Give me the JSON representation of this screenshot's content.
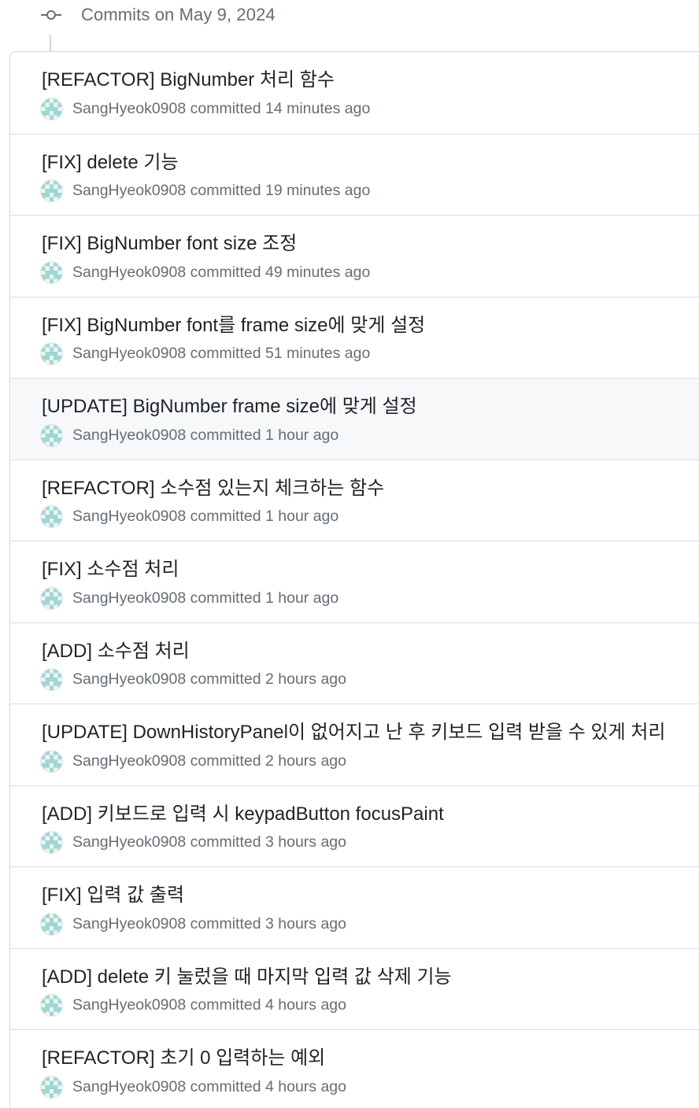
{
  "group": {
    "title": "Commits on May 9, 2024",
    "icon": "git-commit-icon"
  },
  "colors": {
    "avatar_teal": "#9fd7d2",
    "avatar_light": "#eef4f4",
    "hover_row": "#f6f8fa",
    "muted_text": "#656d76"
  },
  "commits": [
    {
      "title": "[REFACTOR] BigNumber 처리 함수",
      "author": "SangHyeok0908",
      "action": "committed",
      "time": "14 minutes ago"
    },
    {
      "title": "[FIX] delete 기능",
      "author": "SangHyeok0908",
      "action": "committed",
      "time": "19 minutes ago"
    },
    {
      "title": "[FIX] BigNumber font size 조정",
      "author": "SangHyeok0908",
      "action": "committed",
      "time": "49 minutes ago"
    },
    {
      "title": "[FIX] BigNumber font를 frame size에 맞게 설정",
      "author": "SangHyeok0908",
      "action": "committed",
      "time": "51 minutes ago"
    },
    {
      "title": "[UPDATE] BigNumber frame size에 맞게 설정",
      "author": "SangHyeok0908",
      "action": "committed",
      "time": "1 hour ago"
    },
    {
      "title": "[REFACTOR] 소수점 있는지 체크하는 함수",
      "author": "SangHyeok0908",
      "action": "committed",
      "time": "1 hour ago"
    },
    {
      "title": "[FIX] 소수점 처리",
      "author": "SangHyeok0908",
      "action": "committed",
      "time": "1 hour ago"
    },
    {
      "title": "[ADD] 소수점 처리",
      "author": "SangHyeok0908",
      "action": "committed",
      "time": "2 hours ago"
    },
    {
      "title": "[UPDATE] DownHistoryPanel이 없어지고 난 후 키보드 입력 받을 수 있게 처리",
      "author": "SangHyeok0908",
      "action": "committed",
      "time": "2 hours ago"
    },
    {
      "title": "[ADD] 키보드로 입력 시 keypadButton focusPaint",
      "author": "SangHyeok0908",
      "action": "committed",
      "time": "3 hours ago"
    },
    {
      "title": "[FIX] 입력 값 출력",
      "author": "SangHyeok0908",
      "action": "committed",
      "time": "3 hours ago"
    },
    {
      "title": "[ADD] delete 키 눌렀을 때 마지막 입력 값 삭제 기능",
      "author": "SangHyeok0908",
      "action": "committed",
      "time": "4 hours ago"
    },
    {
      "title": "[REFACTOR] 초기 0 입력하는 예외",
      "author": "SangHyeok0908",
      "action": "committed",
      "time": "4 hours ago"
    }
  ]
}
